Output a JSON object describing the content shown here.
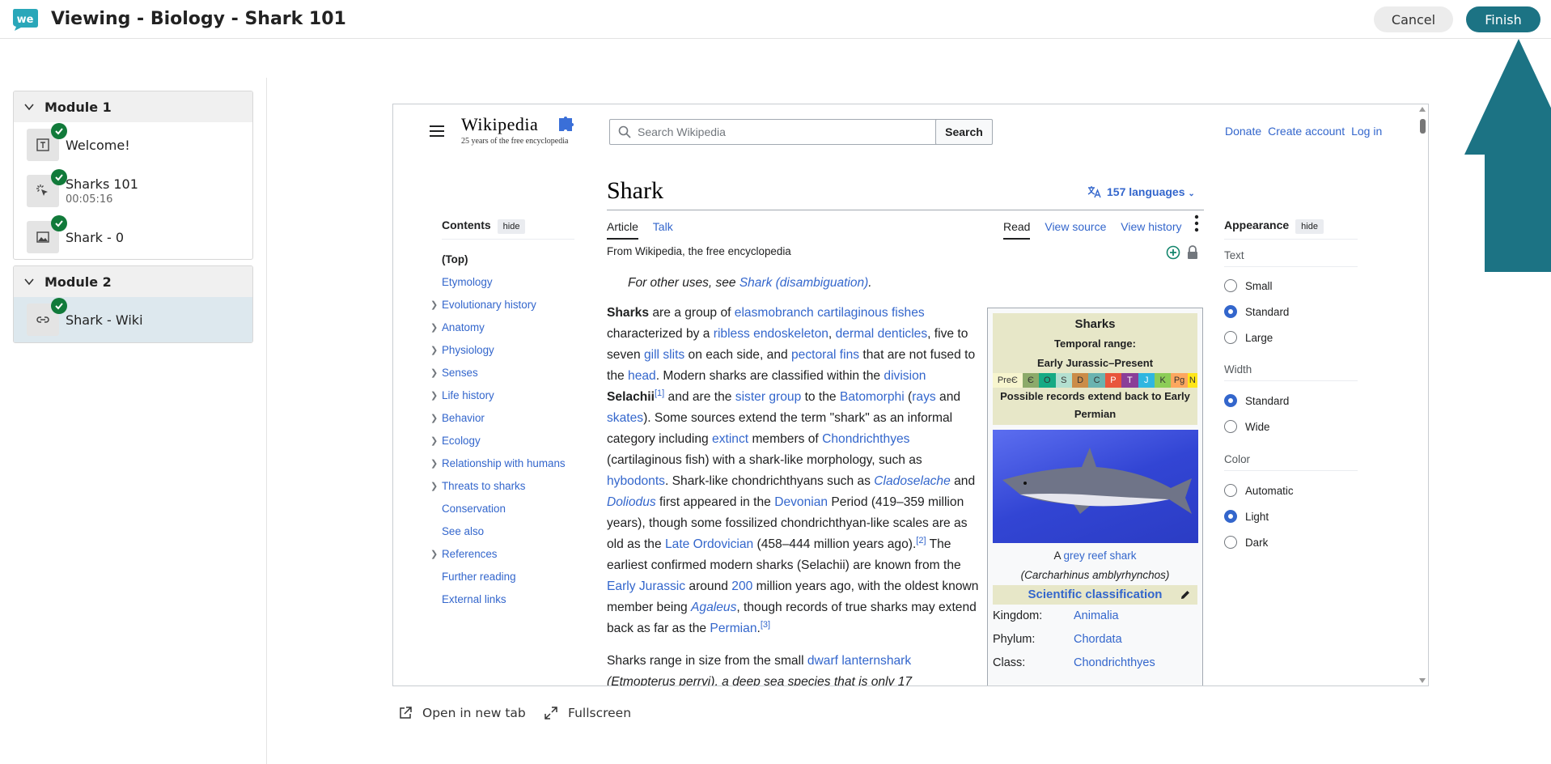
{
  "header": {
    "title": "Viewing - Biology - Shark 101",
    "cancel_label": "Cancel",
    "finish_label": "Finish",
    "logo_text": "we"
  },
  "sidebar": {
    "modules": [
      {
        "title": "Module 1",
        "items": [
          {
            "label": "Welcome!",
            "icon": "text-icon"
          },
          {
            "label": "Sharks 101",
            "sub": "00:05:16",
            "icon": "interactive-icon"
          },
          {
            "label": "Shark - 0",
            "icon": "image-icon"
          }
        ]
      },
      {
        "title": "Module 2",
        "items": [
          {
            "label": "Shark - Wiki",
            "icon": "link-icon"
          }
        ]
      }
    ]
  },
  "wiki": {
    "logo": "Wikipedia",
    "tagline": "25 years of the free encyclopedia",
    "search_placeholder": "Search Wikipedia",
    "search_button": "Search",
    "top_links": [
      "Donate",
      "Create account",
      "Log in"
    ],
    "page_title": "Shark",
    "languages": "157 languages",
    "tabs_left": [
      "Article",
      "Talk"
    ],
    "tabs_right": [
      "Read",
      "View source",
      "View history"
    ],
    "contents": {
      "heading": "Contents",
      "hide": "hide",
      "items": [
        "(Top)",
        "Etymology",
        "Evolutionary history",
        "Anatomy",
        "Physiology",
        "Senses",
        "Life history",
        "Behavior",
        "Ecology",
        "Relationship with humans",
        "Threats to sharks",
        "Conservation",
        "See also",
        "References",
        "Further reading",
        "External links"
      ]
    },
    "from": "From Wikipedia, the free encyclopedia",
    "hatnote_prefix": "For other uses, see ",
    "hatnote_link": "Shark (disambiguation)",
    "p2_prefix": "Sharks range in size from the small ",
    "p2_link": "dwarf lanternshark",
    "p2_line2": "(Etmopterus perryi), a deep sea species that is only 17",
    "infobox": {
      "title": "Sharks",
      "range_label": "Temporal range:",
      "range": "Early Jurassic–Present",
      "geo": [
        "PreЄ",
        "Є",
        "O",
        "S",
        "D",
        "C",
        "P",
        "T",
        "J",
        "K",
        "Pg",
        "N"
      ],
      "note": "Possible records extend back to Early Permian",
      "caption_prefix": "A ",
      "caption_link": "grey reef shark",
      "caption_species": "(Carcharhinus amblyrhynchos)",
      "sci": "Scientific classification",
      "rows": [
        {
          "k": "Kingdom:",
          "v": "Animalia"
        },
        {
          "k": "Phylum:",
          "v": "Chordata"
        },
        {
          "k": "Class:",
          "v": "Chondrichthyes"
        }
      ]
    },
    "appearance": {
      "heading": "Appearance",
      "hide": "hide",
      "text_label": "Text",
      "text_options": [
        "Small",
        "Standard",
        "Large"
      ],
      "text_selected": "Standard",
      "width_label": "Width",
      "width_options": [
        "Standard",
        "Wide"
      ],
      "width_selected": "Standard",
      "color_label": "Color",
      "color_options": [
        "Automatic",
        "Light",
        "Dark"
      ],
      "color_selected": "Light"
    }
  },
  "footer": {
    "open_new_tab": "Open in new tab",
    "fullscreen": "Fullscreen"
  },
  "colors": {
    "brand": "#1c7384",
    "check": "#117a3a",
    "link": "#3366cc"
  }
}
